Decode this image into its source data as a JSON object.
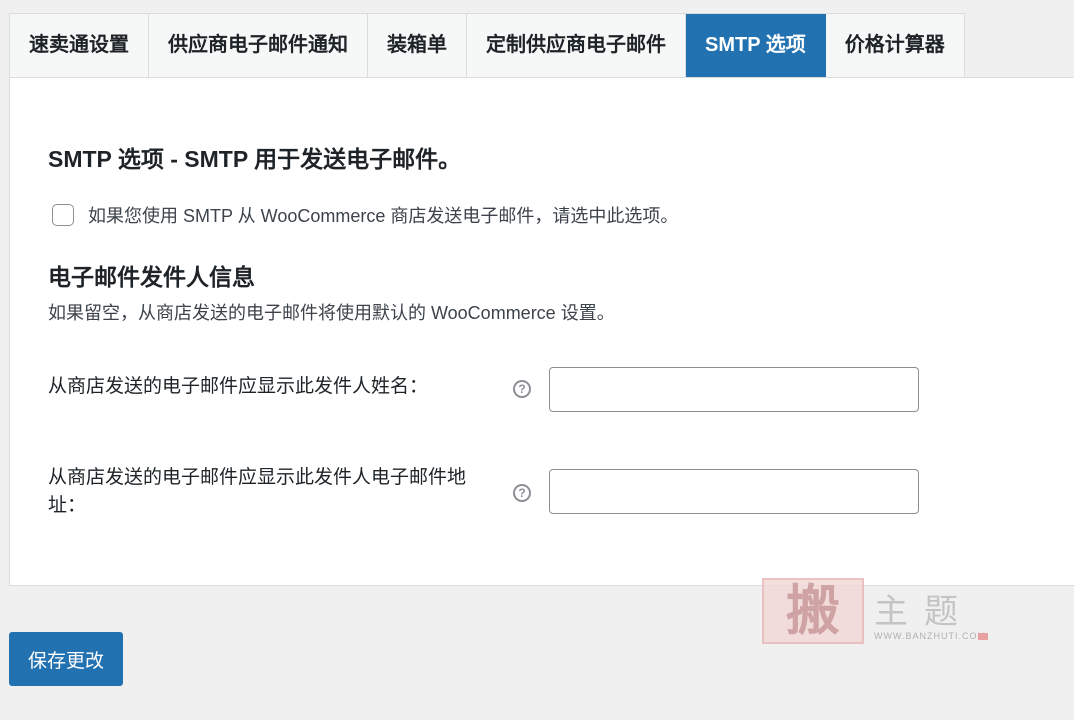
{
  "tabs": [
    {
      "label": "速卖通设置",
      "active": false
    },
    {
      "label": "供应商电子邮件通知",
      "active": false
    },
    {
      "label": "装箱单",
      "active": false
    },
    {
      "label": "定制供应商电子邮件",
      "active": false
    },
    {
      "label": "SMTP 选项",
      "active": true
    },
    {
      "label": "价格计算器",
      "active": false
    }
  ],
  "smtp": {
    "heading": "SMTP 选项 - SMTP 用于发送电子邮件。",
    "checkbox_label": "如果您使用 SMTP 从 WooCommerce 商店发送电子邮件，请选中此选项。",
    "checked": false
  },
  "sender": {
    "heading": "电子邮件发件人信息",
    "description": "如果留空，从商店发送的电子邮件将使用默认的 WooCommerce 设置。",
    "name_label": "从商店发送的电子邮件应显示此发件人姓名：",
    "name_value": "",
    "email_label": "从商店发送的电子邮件应显示此发件人电子邮件地址：",
    "email_value": ""
  },
  "save_button_label": "保存更改",
  "watermark": {
    "seal_char": "搬",
    "text": "主题",
    "url": "WWW.BANZHUTI.COM"
  },
  "colors": {
    "accent": "#2271b1",
    "background": "#f0f0f1",
    "panel": "#ffffff"
  }
}
